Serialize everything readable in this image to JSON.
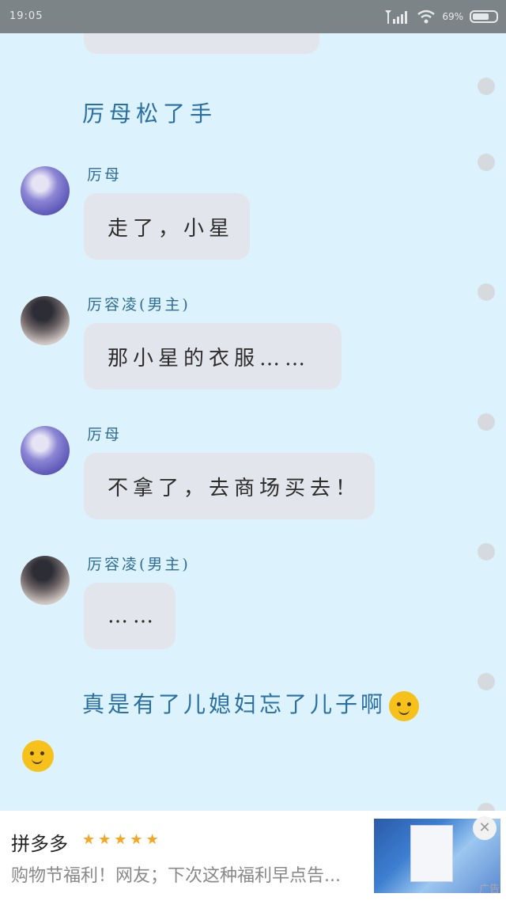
{
  "status_bar": {
    "time": "19:05",
    "battery": "69%"
  },
  "story": {
    "narration_1": "厉母松了手",
    "messages": [
      {
        "speaker": "厉母",
        "text": "走了，小星"
      },
      {
        "speaker": "厉容凌(男主)",
        "text": "那小星的衣服……"
      },
      {
        "speaker": "厉母",
        "text": "不拿了，去商场买去！"
      },
      {
        "speaker": "厉容凌(男主)",
        "text": "……"
      }
    ],
    "narration_2": "真是有了儿媳妇忘了儿子啊"
  },
  "ad": {
    "title": "拼多多",
    "stars": "★★★★★",
    "description": "购物节福利！网友；下次这种福利早点告...",
    "close": "✕",
    "tag": "广告"
  },
  "icons": [
    "signal-icon",
    "wifi-icon",
    "battery-icon",
    "emoji-smile-icon",
    "close-icon"
  ],
  "colors": {
    "background": "#dcf2fd",
    "bubble": "#e2e6ec",
    "narration": "#2a6fa3",
    "status_bar": "#7d8488"
  }
}
